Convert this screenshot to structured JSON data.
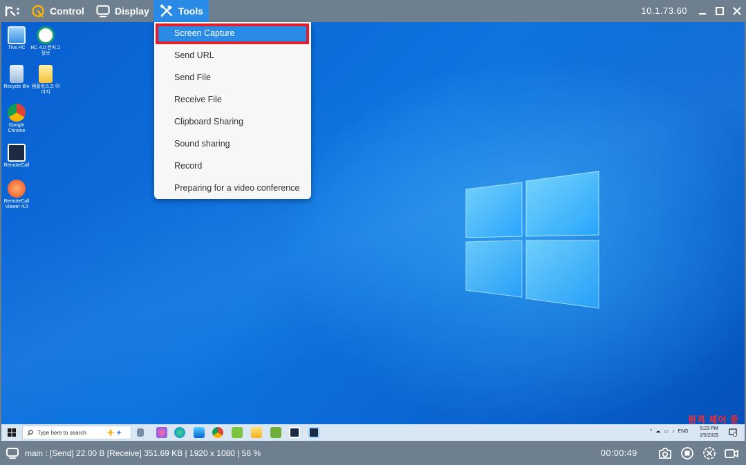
{
  "window": {
    "menus": [
      {
        "label": "Control",
        "icon": "remote-control-icon"
      },
      {
        "label": "Display",
        "icon": "monitor-icon"
      },
      {
        "label": "Tools",
        "icon": "tools-icon"
      }
    ],
    "ip_address": "10.1.73.60"
  },
  "tools_menu": {
    "items": [
      "Screen Capture",
      "Send URL",
      "Send File",
      "Receive File",
      "Clipboard Sharing",
      "Sound sharing",
      "Record",
      "Preparing for a video conference"
    ],
    "selected_index": 0
  },
  "desktop": {
    "icons": [
      {
        "label": "This PC",
        "icon": "computer-icon"
      },
      {
        "label": "RC 4.0 컨피그 정보",
        "icon": "pdf-icon"
      },
      {
        "label": "Recycle Bin",
        "icon": "recycle-bin-icon"
      },
      {
        "label": "템플릿스크 이미지",
        "icon": "folder-icon"
      },
      {
        "label": "Google Chrome",
        "icon": "chrome-icon"
      },
      {
        "label": "RemoteCall",
        "icon": "remotecall-icon"
      },
      {
        "label": "RemoteCall Viewer 4.0",
        "icon": "remotecall-viewer-icon"
      }
    ],
    "watermark": "원격 제어 중",
    "taskbar": {
      "search_placeholder": "Type here to search",
      "tray_lang": "ENG",
      "clock_time": "5:23 PM",
      "clock_date": "2/5/2025"
    }
  },
  "status_bar": {
    "status_text": "main : [Send] 22.00 B  [Receive] 351.69 KB | 1920 x 1080 | 56 %",
    "timer": "00:00:49"
  },
  "colors": {
    "title_bar": "#6e7f90",
    "accent": "#2a8be6",
    "highlight_border": "#e31e2c",
    "watermark": "#ff2a2a"
  }
}
